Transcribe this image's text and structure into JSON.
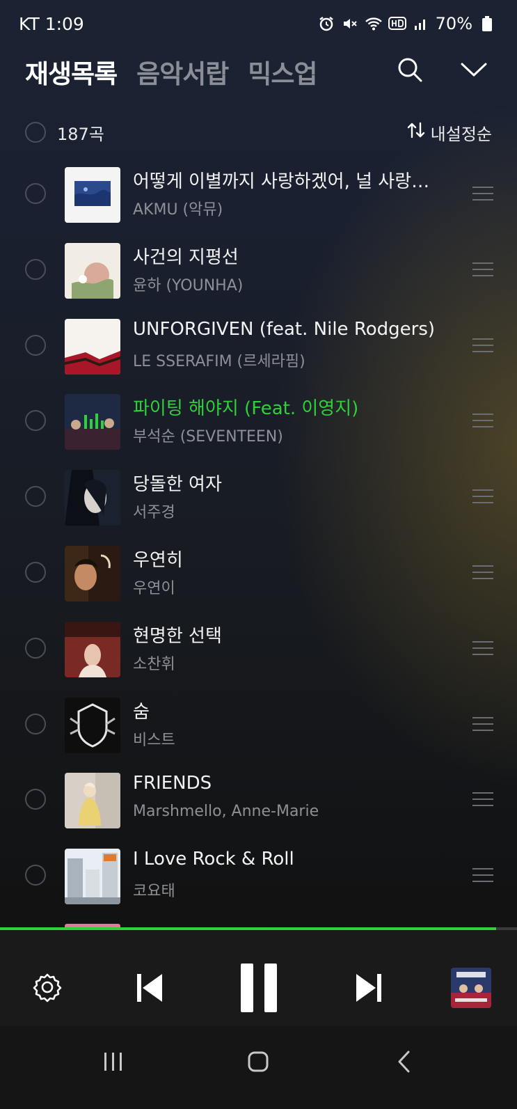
{
  "status_bar": {
    "carrier": "KT",
    "time": "1:09",
    "battery": "70%"
  },
  "tabs": [
    {
      "label": "재생목록",
      "active": true
    },
    {
      "label": "음악서랍",
      "active": false
    },
    {
      "label": "믹스업",
      "active": false
    }
  ],
  "list_header": {
    "count": "187곡",
    "sort_label": "내설정순"
  },
  "tracks": [
    {
      "title": "어떻게 이별까지 사랑하겠어, 널 사랑하는 거지",
      "artist": "AKMU (악뮤)",
      "playing": false
    },
    {
      "title": "사건의 지평선",
      "artist": "윤하 (YOUNHA)",
      "playing": false
    },
    {
      "title": "UNFORGIVEN (feat. Nile Rodgers)",
      "artist": "LE SSERAFIM (르세라핌)",
      "playing": false
    },
    {
      "title": "파이팅 해야지 (Feat. 이영지)",
      "artist": "부석순 (SEVENTEEN)",
      "playing": true
    },
    {
      "title": "당돌한 여자",
      "artist": "서주경",
      "playing": false
    },
    {
      "title": "우연히",
      "artist": "우연이",
      "playing": false
    },
    {
      "title": "현명한 선택",
      "artist": "소찬휘",
      "playing": false
    },
    {
      "title": "숨",
      "artist": "비스트",
      "playing": false
    },
    {
      "title": "FRIENDS",
      "artist": "Marshmello, Anne-Marie",
      "playing": false
    },
    {
      "title": "I Love Rock & Roll",
      "artist": "코요태",
      "playing": false
    }
  ],
  "player": {
    "progress": 0.96,
    "accent_color": "#2fd13a"
  },
  "icons": {
    "header": [
      "search-icon",
      "chevron-down-icon"
    ],
    "player": [
      "settings-icon",
      "previous-icon",
      "pause-icon",
      "next-icon"
    ],
    "nav": [
      "recent-apps-icon",
      "home-icon",
      "back-icon"
    ]
  }
}
